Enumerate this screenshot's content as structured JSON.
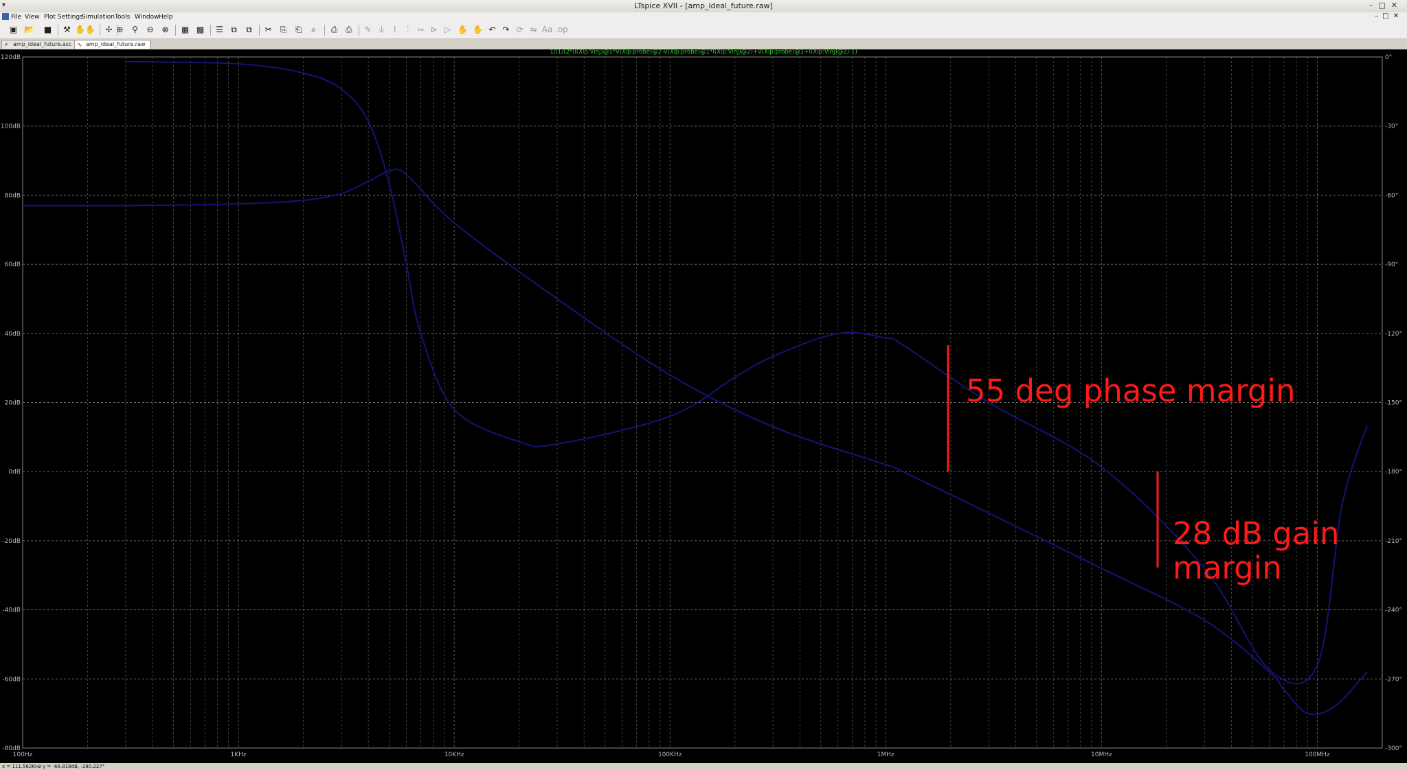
{
  "window": {
    "title": "LTspice XVII - [amp_ideal_future.raw]"
  },
  "menu": [
    "File",
    "View",
    "Plot Settings",
    "Simulation",
    "Tools",
    "Window",
    "Help"
  ],
  "toolbar_icons": [
    "new-schematic-icon",
    "open-icon",
    "save-icon",
    "control-panel-icon",
    "run-icon",
    "halt-icon",
    "pick-visible-traces-icon",
    "zoom-in-icon",
    "zoom-area-icon",
    "zoom-out-icon",
    "zoom-cancel-icon",
    "autorange-icon",
    "zoom-full-icon",
    "tile-vertical-icon",
    "tile-horizontal-icon",
    "cascade-icon",
    "cut-icon",
    "copy-icon",
    "paste-icon",
    "find-icon",
    "print-icon",
    "print-preview-icon",
    "wire-icon",
    "ground-icon",
    "resistor-icon",
    "capacitor-icon",
    "inductor-icon",
    "diode-icon",
    "component-icon",
    "move-icon",
    "drag-icon",
    "undo-icon",
    "redo-icon",
    "rotate-icon",
    "mirror-icon",
    "text-icon",
    "spice-directive-icon"
  ],
  "tabs": [
    {
      "label": "amp_ideal_future.asc",
      "icon": "schematic-icon",
      "active": false
    },
    {
      "label": "amp_ideal_future.raw",
      "icon": "waveform-icon",
      "active": true
    }
  ],
  "plot": {
    "expression": "1/(1/(2*(I(Xlp:Vinj)@1*V(Xlp:probe)@2-V(Xlp:probe)@1*I(Xlp:Vinj)@2)+V(Xlp:probe)@1+I(Xlp:Vinj)@2)-1)",
    "expression_color": "#33cc33",
    "trace_color": "#141478",
    "annotation_color": "#ff1a1a",
    "background": "#000000"
  },
  "chart_data": {
    "type": "line",
    "x_scale": "log",
    "xlim": [
      100,
      200000000
    ],
    "ylim_left": [
      -80,
      120
    ],
    "ylim_right": [
      -300,
      0
    ],
    "x_tick_labels": [
      "100Hz",
      "1KHz",
      "10KHz",
      "100KHz",
      "1MHz",
      "10MHz",
      "100MHz"
    ],
    "y_left_tick_labels": [
      "120dB",
      "100dB",
      "80dB",
      "60dB",
      "40dB",
      "20dB",
      "0dB",
      "-20dB",
      "-40dB",
      "-60dB",
      "-80dB"
    ],
    "y_right_tick_labels": [
      "0°",
      "-30°",
      "-60°",
      "-90°",
      "-120°",
      "-150°",
      "-180°",
      "-210°",
      "-240°",
      "-270°",
      "-300°"
    ],
    "series": [
      {
        "axis": "left",
        "x": [
          100,
          300,
          1000,
          2000,
          3000,
          4000,
          5000,
          6000,
          10000,
          30000,
          100000,
          300000,
          1000000,
          1200000,
          3000000,
          10000000,
          30000000,
          60000000,
          70000000,
          90000000,
          120000000,
          170000000
        ],
        "y": [
          77,
          77,
          77.5,
          78.5,
          80.5,
          84,
          87,
          86,
          72,
          50,
          28,
          13,
          2,
          0,
          -12,
          -28,
          -43,
          -58,
          -63,
          -70,
          -68,
          -58
        ]
      },
      {
        "axis": "right",
        "x": [
          300,
          1000,
          2000,
          3000,
          4000,
          5000,
          6000,
          7000,
          10000,
          20000,
          30000,
          100000,
          200000,
          300000,
          600000,
          1000000,
          1200000,
          3000000,
          10000000,
          30000000,
          60000000,
          100000000,
          130000000,
          170000000
        ],
        "y": [
          -2,
          -3,
          -7,
          -14,
          -28,
          -55,
          -90,
          -120,
          -153,
          -167,
          -168,
          -156,
          -139,
          -130,
          -120,
          -122,
          -125,
          -150,
          -178,
          -222,
          -266,
          -264,
          -195,
          -160
        ]
      }
    ],
    "annotations": [
      "55 deg phase margin",
      "28 dB gain\nmargin"
    ]
  },
  "annotations": {
    "phase_margin_text": "55 deg phase margin",
    "gain_margin_line1": "28 dB gain",
    "gain_margin_line2": "margin"
  },
  "status": {
    "cursor_readout": "x = 111.562KHz    y = -66.818dB, -280.227°"
  }
}
